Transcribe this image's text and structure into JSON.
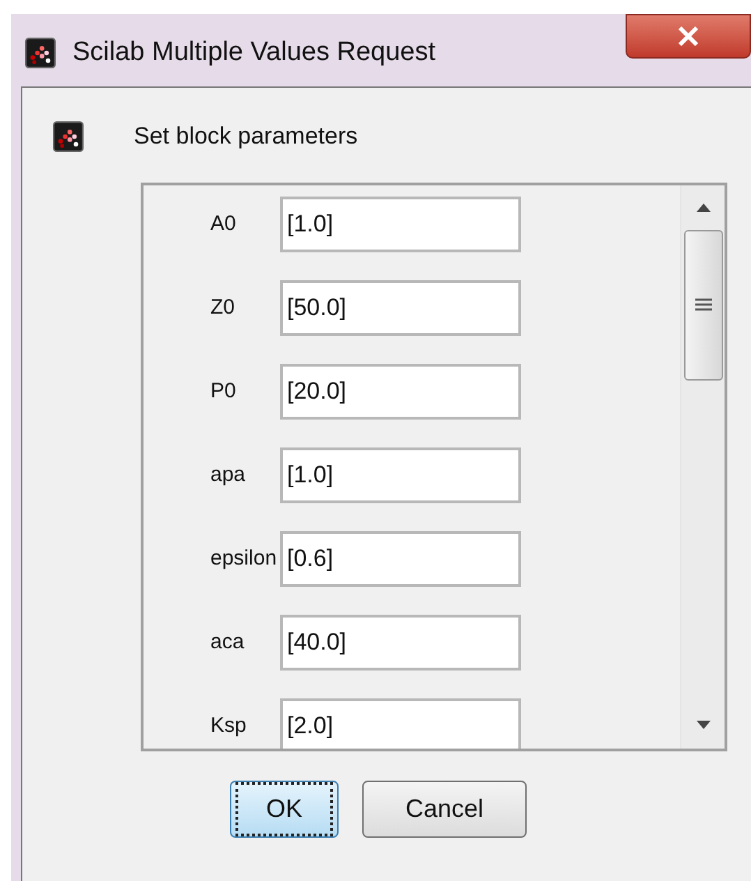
{
  "window": {
    "title": "Scilab Multiple Values Request"
  },
  "header": "Set block parameters",
  "fields": [
    {
      "label": "A0",
      "value": "[1.0]"
    },
    {
      "label": "Z0",
      "value": "[50.0]"
    },
    {
      "label": "P0",
      "value": "[20.0]"
    },
    {
      "label": "apa",
      "value": "[1.0]"
    },
    {
      "label": "epsilon",
      "value": "[0.6]"
    },
    {
      "label": "aca",
      "value": "[40.0]"
    },
    {
      "label": "Ksp",
      "value": "[2.0]"
    }
  ],
  "buttons": [
    {
      "label": "OK",
      "focused": true
    },
    {
      "label": "Cancel",
      "focused": false
    }
  ]
}
